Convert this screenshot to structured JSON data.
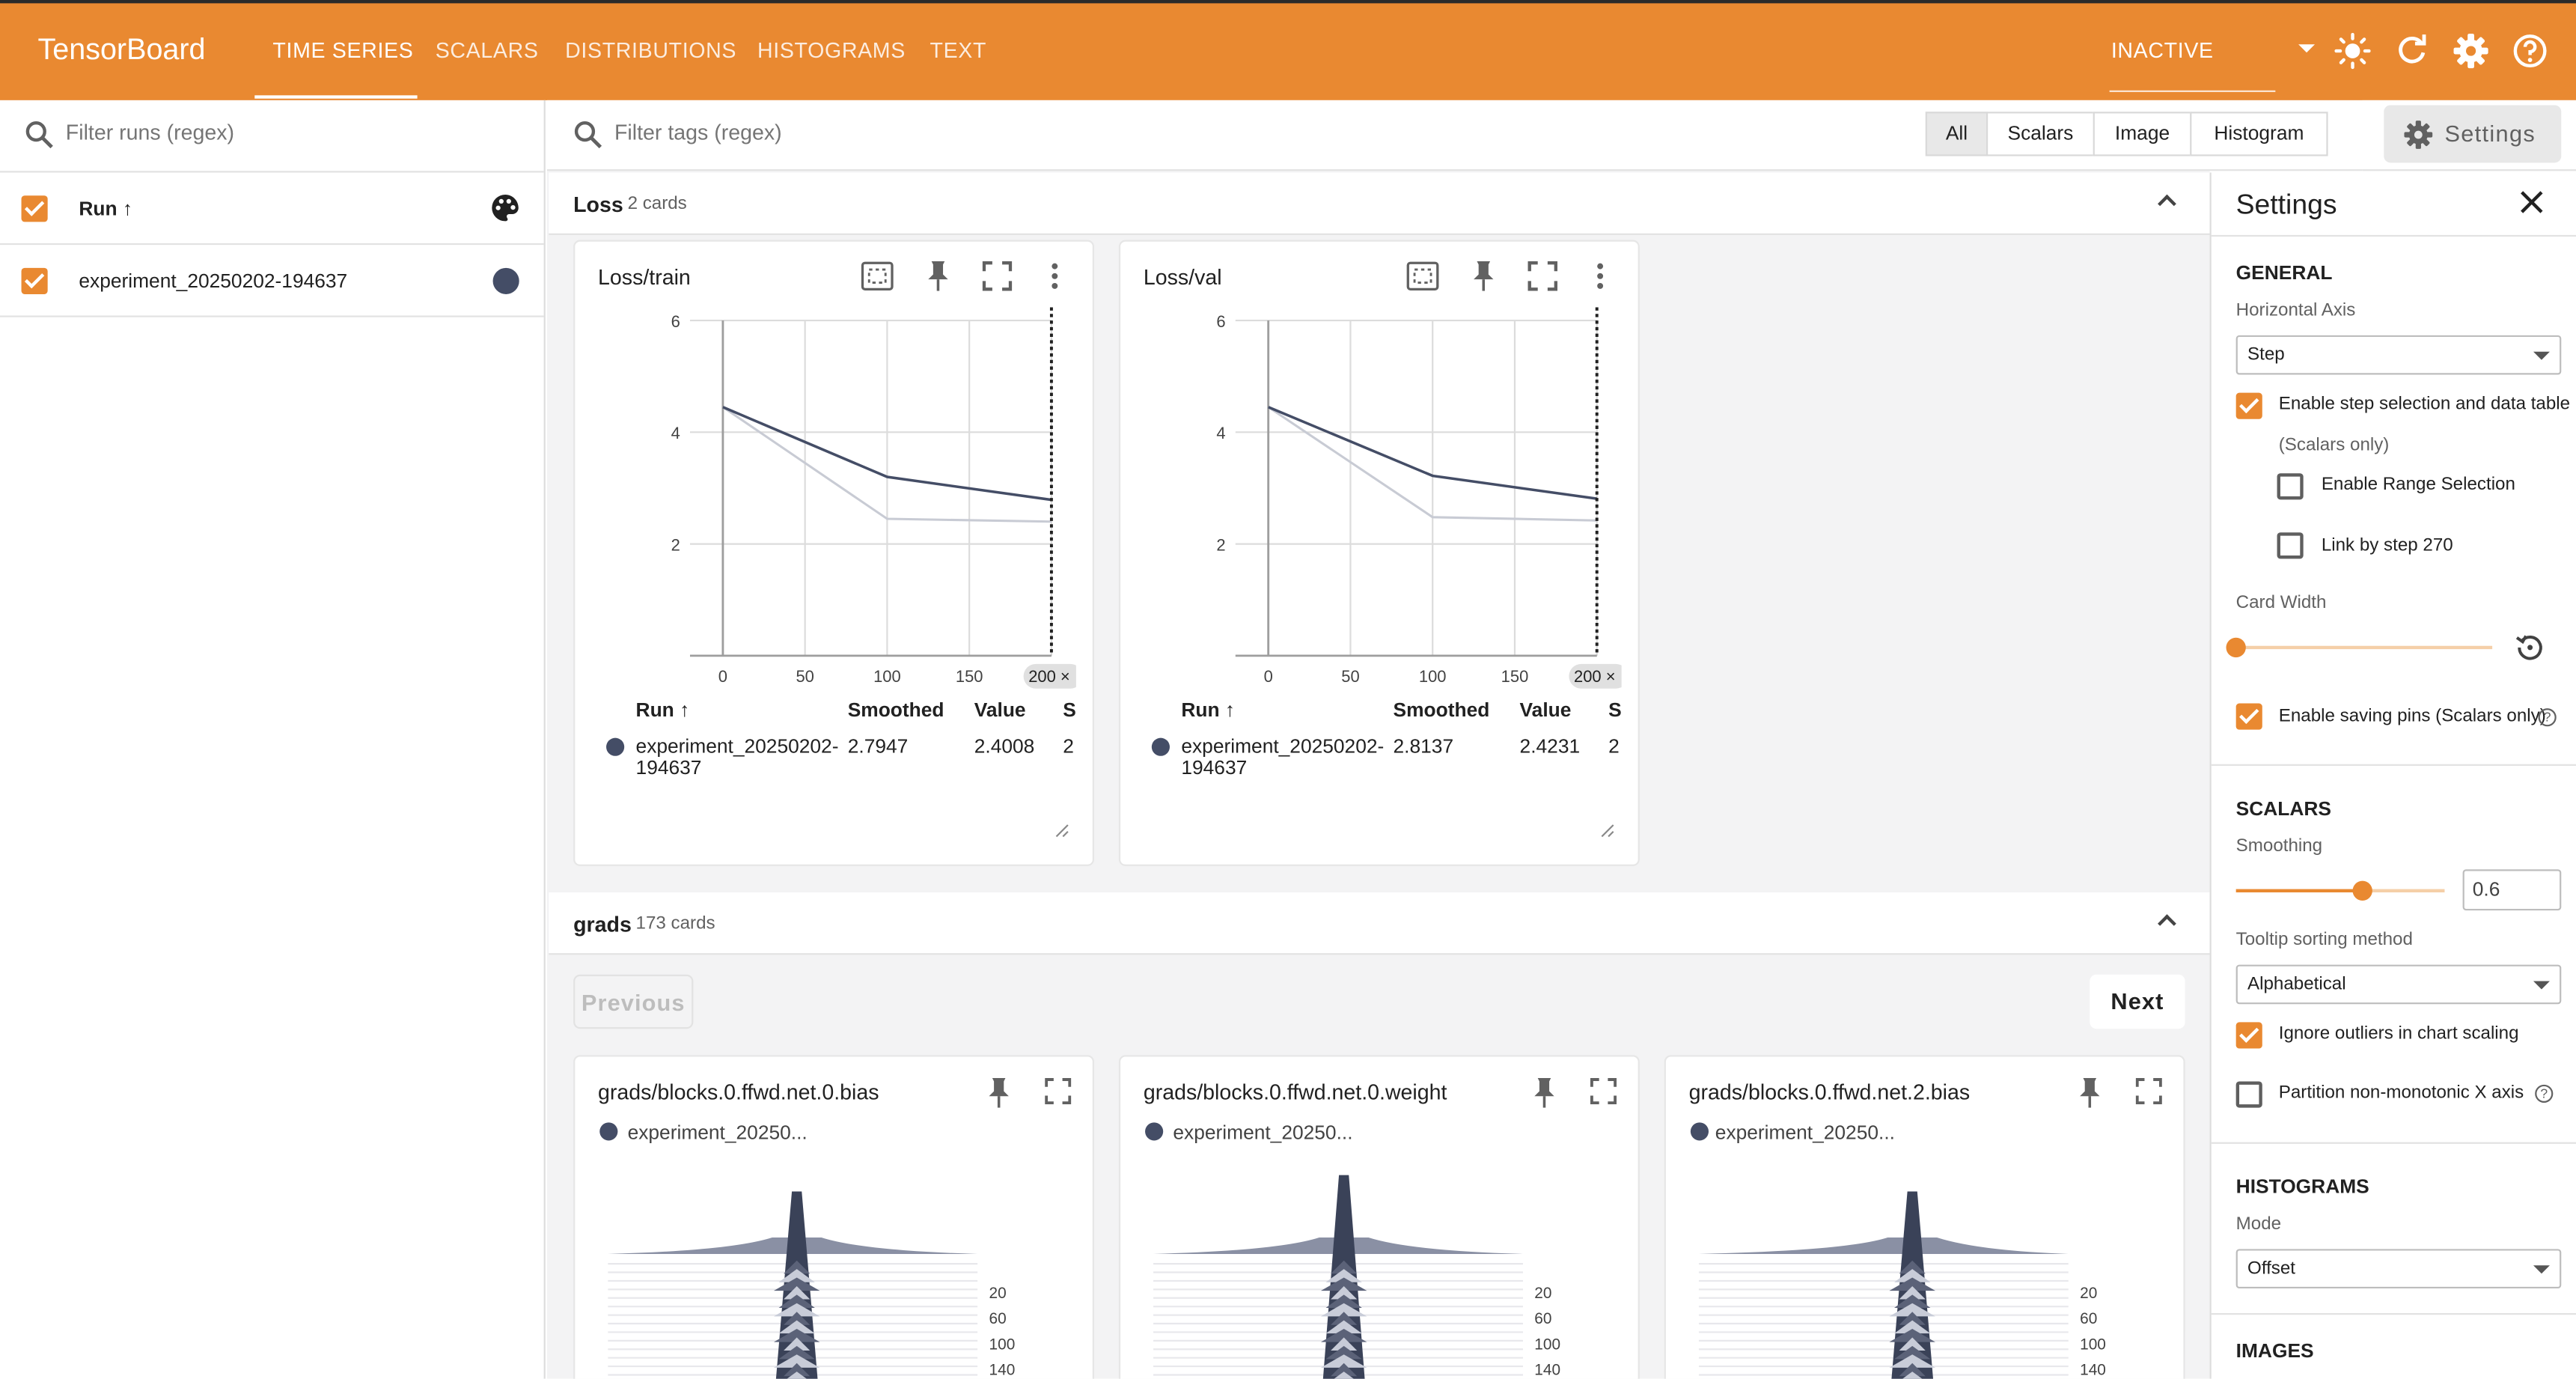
{
  "topbar": {
    "brand": "TensorBoard",
    "tabs": [
      {
        "label": "TIME SERIES",
        "active": true
      },
      {
        "label": "SCALARS",
        "active": false
      },
      {
        "label": "DISTRIBUTIONS",
        "active": false
      },
      {
        "label": "HISTOGRAMS",
        "active": false
      },
      {
        "label": "TEXT",
        "active": false
      }
    ],
    "status": "INACTIVE",
    "icons": [
      "theme-toggle-icon",
      "reload-icon",
      "settings-gear-icon",
      "help-icon"
    ],
    "color": "#e98931"
  },
  "runs": {
    "filter_placeholder": "Filter runs (regex)",
    "header_label": "Run ↑",
    "items": [
      {
        "name": "experiment_20250202-194637",
        "checked": true,
        "color": "#444d66"
      }
    ]
  },
  "main": {
    "tag_filter_placeholder": "Filter tags (regex)",
    "type_filters": [
      {
        "label": "All",
        "active": true
      },
      {
        "label": "Scalars",
        "active": false
      },
      {
        "label": "Image",
        "active": false
      },
      {
        "label": "Histogram",
        "active": false
      }
    ],
    "settings_button": "Settings",
    "groups": [
      {
        "name": "Loss",
        "count": "2 cards"
      },
      {
        "name": "grads",
        "count": "173 cards"
      }
    ],
    "pager": {
      "previous": "Previous",
      "next": "Next"
    }
  },
  "scalar_cards": [
    {
      "title": "Loss/train",
      "step_chip": "200",
      "table_headers": [
        "Run ↑",
        "Smoothed",
        "Value",
        "S"
      ],
      "row": {
        "run_line1": "experiment_20250202-",
        "run_line2": "194637",
        "smoothed": "2.7947",
        "value": "2.4008",
        "extra": "2"
      }
    },
    {
      "title": "Loss/val",
      "step_chip": "200",
      "table_headers": [
        "Run ↑",
        "Smoothed",
        "Value",
        "S"
      ],
      "row": {
        "run_line1": "experiment_20250202-",
        "run_line2": "194637",
        "smoothed": "2.8137",
        "value": "2.4231",
        "extra": "2"
      }
    }
  ],
  "chart_data": [
    {
      "type": "line",
      "title": "Loss/train",
      "x_ticks": [
        "0",
        "50",
        "100",
        "150"
      ],
      "y_ticks": [
        "2",
        "4",
        "6"
      ],
      "xlim": [
        0,
        200
      ],
      "ylim": [
        0,
        6
      ],
      "selected_step": 200,
      "grid": true,
      "series": [
        {
          "name": "experiment_20250202-194637",
          "kind": "smoothed",
          "color": "#444d66",
          "x": [
            0,
            100,
            200
          ],
          "y": [
            4.45,
            3.2,
            2.79
          ]
        },
        {
          "name": "experiment_20250202-194637",
          "kind": "raw",
          "color": "#c8cbd4",
          "x": [
            0,
            100,
            200
          ],
          "y": [
            4.45,
            2.45,
            2.4
          ]
        }
      ]
    },
    {
      "type": "line",
      "title": "Loss/val",
      "x_ticks": [
        "0",
        "50",
        "100",
        "150"
      ],
      "y_ticks": [
        "2",
        "4",
        "6"
      ],
      "xlim": [
        0,
        200
      ],
      "ylim": [
        0,
        6
      ],
      "selected_step": 200,
      "grid": true,
      "series": [
        {
          "name": "experiment_20250202-194637",
          "kind": "smoothed",
          "color": "#444d66",
          "x": [
            0,
            100,
            200
          ],
          "y": [
            4.45,
            3.22,
            2.81
          ]
        },
        {
          "name": "experiment_20250202-194637",
          "kind": "raw",
          "color": "#c8cbd4",
          "x": [
            0,
            100,
            200
          ],
          "y": [
            4.45,
            2.48,
            2.42
          ]
        }
      ]
    }
  ],
  "histogram_cards": [
    {
      "title": "grads/blocks.0.ffwd.net.0.bias",
      "run": "experiment_20250...",
      "y_ticks": [
        "20",
        "60",
        "100",
        "140"
      ]
    },
    {
      "title": "grads/blocks.0.ffwd.net.0.weight",
      "run": "experiment_20250...",
      "y_ticks": [
        "20",
        "60",
        "100",
        "140"
      ]
    },
    {
      "title": "grads/blocks.0.ffwd.net.2.bias",
      "run": "experiment_20250...",
      "y_ticks": [
        "20",
        "60",
        "100",
        "140"
      ]
    }
  ],
  "settings": {
    "title": "Settings",
    "general": {
      "heading": "GENERAL",
      "horizontal_axis_label": "Horizontal Axis",
      "horizontal_axis_value": "Step",
      "step_selection_label": "Enable step selection and data table",
      "step_selection_sub": "(Scalars only)",
      "step_selection_checked": true,
      "range_selection_label": "Enable Range Selection",
      "range_selection_checked": false,
      "link_by_step_label": "Link by step 270",
      "link_by_step_checked": false,
      "card_width_label": "Card Width",
      "card_width_level": 0,
      "saving_pins_label": "Enable saving pins (Scalars only)",
      "saving_pins_checked": true
    },
    "scalars": {
      "heading": "SCALARS",
      "smoothing_label": "Smoothing",
      "smoothing_value": "0.6",
      "tooltip_sort_label": "Tooltip sorting method",
      "tooltip_sort_value": "Alphabetical",
      "ignore_outliers_label": "Ignore outliers in chart scaling",
      "ignore_outliers_checked": true,
      "partition_label": "Partition non-monotonic X axis",
      "partition_checked": false
    },
    "histograms": {
      "heading": "HISTOGRAMS",
      "mode_label": "Mode",
      "mode_value": "Offset"
    },
    "images": {
      "heading": "IMAGES"
    }
  }
}
